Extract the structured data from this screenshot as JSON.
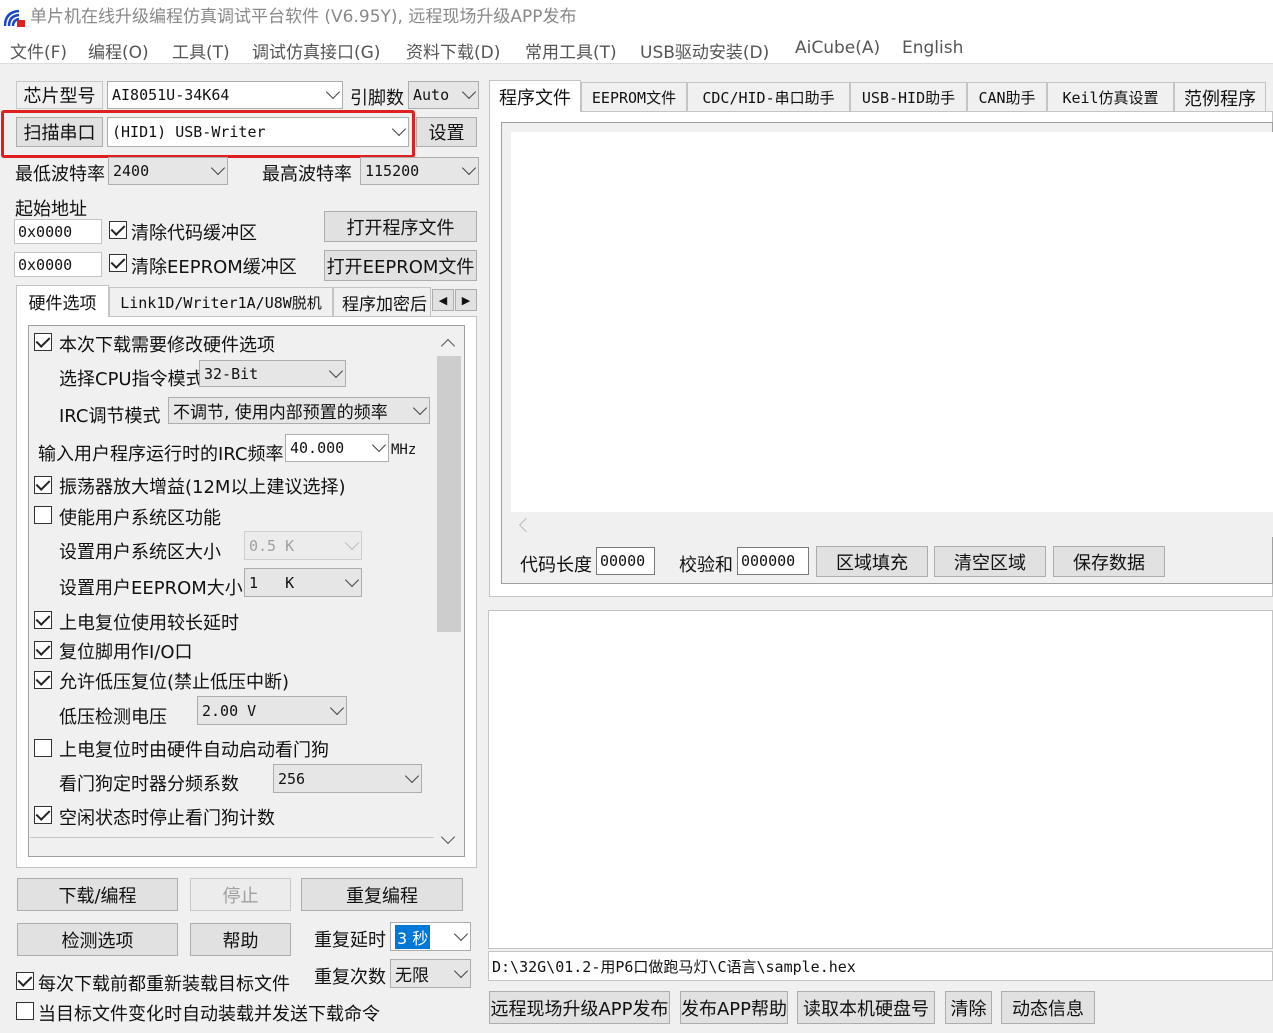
{
  "window": {
    "title": "单片机在线升级编程仿真调试平台软件 (V6.95Y), 远程现场升级APP发布"
  },
  "menu": [
    "文件(F)",
    "编程(O)",
    "工具(T)",
    "调试仿真接口(G)",
    "资料下载(D)",
    "常用工具(T)",
    "USB驱动安装(D)",
    "AiCube(A)",
    "English"
  ],
  "left": {
    "chip_label": "芯片型号",
    "chip_value": "AI8051U-34K64",
    "pins_label": "引脚数",
    "pins_value": "Auto",
    "scan_button": "扫描串口",
    "port_value": "(HID1) USB-Writer",
    "settings_button": "设置",
    "min_baud_label": "最低波特率",
    "min_baud_value": "2400",
    "max_baud_label": "最高波特率",
    "max_baud_value": "115200",
    "start_addr_label": "起始地址",
    "code_addr": "0x0000",
    "clear_code_label": "清除代码缓冲区",
    "open_program_button": "打开程序文件",
    "eeprom_addr": "0x0000",
    "clear_eeprom_label": "清除EEPROM缓冲区",
    "open_eeprom_button": "打开EEPROM文件",
    "subtabs": [
      "硬件选项",
      "Link1D/Writer1A/U8W脱机",
      "程序加密后"
    ],
    "hw_options": {
      "modify_hw": "本次下载需要修改硬件选项",
      "cpu_mode_label": "选择CPU指令模式",
      "cpu_mode_value": "32-Bit",
      "irc_mode_label": "IRC调节模式",
      "irc_mode_value": "不调节, 使用内部预置的频率",
      "irc_freq_label": "输入用户程序运行时的IRC频率",
      "irc_freq_value": "40.000",
      "irc_freq_unit": "MHz",
      "osc_gain": "振荡器放大增益(12M以上建议选择)",
      "user_sys_area": "使能用户系统区功能",
      "user_sys_size_label": "设置用户系统区大小",
      "user_sys_size_value": "0.5 K",
      "user_eeprom_label": "设置用户EEPROM大小",
      "user_eeprom_value": "1   K",
      "long_delay": "上电复位使用较长延时",
      "reset_io": "复位脚用作I/O口",
      "lvr": "允许低压复位(禁止低压中断)",
      "lvd_label": "低压检测电压",
      "lvd_value": "2.00 V",
      "wdt_auto": "上电复位时由硬件自动启动看门狗",
      "wdt_div_label": "看门狗定时器分频系数",
      "wdt_div_value": "256",
      "wdt_idle_stop": "空闲状态时停止看门狗计数"
    },
    "download_button": "下载/编程",
    "stop_button": "停止",
    "repeat_button": "重复编程",
    "check_button": "检测选项",
    "help_button": "帮助",
    "repeat_delay_label": "重复延时",
    "repeat_delay_value": "3 秒",
    "repeat_count_label": "重复次数",
    "repeat_count_value": "无限",
    "reload_label": "每次下载前都重新装载目标文件",
    "auto_load_label": "当目标文件变化时自动装载并发送下载命令"
  },
  "right": {
    "tabs": [
      "程序文件",
      "EEPROM文件",
      "CDC/HID-串口助手",
      "USB-HID助手",
      "CAN助手",
      "Keil仿真设置",
      "范例程序"
    ],
    "code_len_label": "代码长度",
    "code_len_value": "00000",
    "checksum_label": "校验和",
    "checksum_value": "000000",
    "fill_button": "区域填充",
    "clear_area_button": "清空区域",
    "save_button": "保存数据",
    "file_path": "D:\\32G\\01.2-用P6口做跑马灯\\C语言\\sample.hex",
    "remote_button": "远程现场升级APP发布",
    "app_help_button": "发布APP帮助",
    "read_disk_button": "读取本机硬盘号",
    "clear_button": "清除",
    "dynamic_button": "动态信息"
  }
}
